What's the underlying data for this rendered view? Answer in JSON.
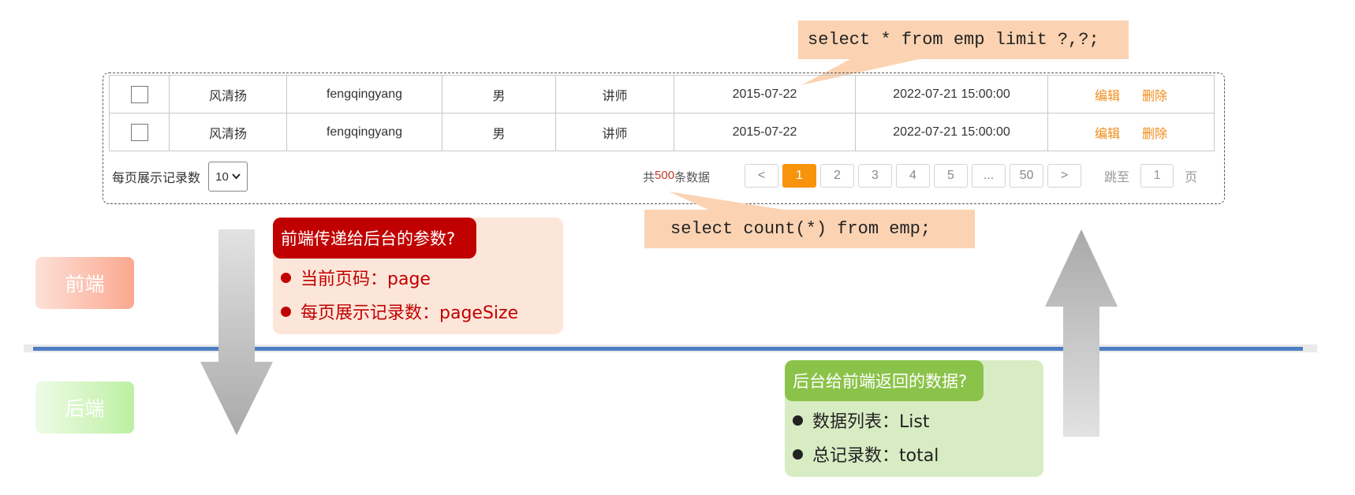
{
  "sql": {
    "top": "select * from emp limit ?,?;",
    "bottom": "select count(*) from emp;"
  },
  "table": {
    "rows": [
      {
        "name": "风清扬",
        "username": "fengqingyang",
        "gender": "男",
        "job": "讲师",
        "entry_date": "2015-07-22",
        "update_time": "2022-07-21 15:00:00",
        "edit": "编辑",
        "delete": "删除"
      },
      {
        "name": "风清扬",
        "username": "fengqingyang",
        "gender": "男",
        "job": "讲师",
        "entry_date": "2015-07-22",
        "update_time": "2022-07-21 15:00:00",
        "edit": "编辑",
        "delete": "删除"
      }
    ]
  },
  "pagination": {
    "page_size_label": "每页展示记录数",
    "page_size_value": "10",
    "total_prefix": "共",
    "total_count": "500",
    "total_suffix": "条数据",
    "prev": "<",
    "pages": [
      "1",
      "2",
      "3",
      "4",
      "5",
      "...",
      "50"
    ],
    "current_page": "1",
    "next": ">",
    "jump_label": "跳至",
    "jump_value": "1",
    "jump_suffix": "页"
  },
  "labels": {
    "front": "前端",
    "back": "后端"
  },
  "front_card": {
    "title": "前端传递给后台的参数?",
    "items": [
      "当前页码：page",
      "每页展示记录数：pageSize"
    ]
  },
  "back_card": {
    "title": "后台给前端返回的数据?",
    "items": [
      "数据列表：List",
      "总记录数：total"
    ]
  },
  "colors": {
    "accent_orange": "#f7940b",
    "front_red": "#c00000",
    "back_green": "#8bc34a",
    "divider_blue": "#4f7ec1"
  }
}
